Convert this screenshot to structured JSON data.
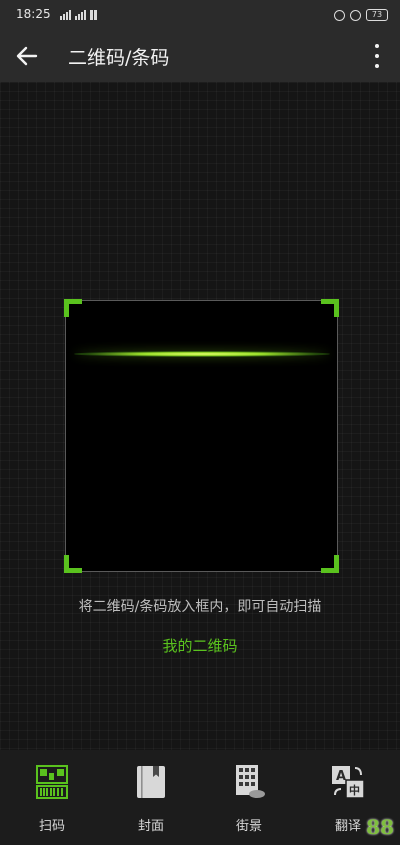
{
  "status_bar": {
    "time": "18:25",
    "battery": "73"
  },
  "app_bar": {
    "title": "二维码/条码",
    "back_icon": "arrow-left",
    "more_icon": "more-vertical"
  },
  "scanner": {
    "hint": "将二维码/条码放入框内，即可自动扫描",
    "my_qr_link": "我的二维码",
    "accent_color": "#5ac21e"
  },
  "tabs": [
    {
      "label": "扫码",
      "icon": "qr-scan-icon",
      "active": true
    },
    {
      "label": "封面",
      "icon": "book-icon",
      "active": false
    },
    {
      "label": "街景",
      "icon": "building-icon",
      "active": false
    },
    {
      "label": "翻译",
      "icon": "translate-icon",
      "active": false
    }
  ],
  "watermark": "88"
}
